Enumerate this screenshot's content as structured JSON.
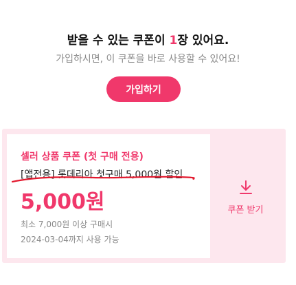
{
  "header": {
    "headline_prefix": "받을 수 있는 쿠폰이 ",
    "headline_count": "1",
    "headline_suffix": "장 있어요.",
    "subline": "가입하시면, 이 쿠폰을 바로 사용할 수 있어요!",
    "join_button": "가입하기"
  },
  "coupon": {
    "tag": "셀러 상품 쿠폰 (첫 구매 전용)",
    "name": "[앱전용] 롯데리아 첫구매 5,000원 할인",
    "amount": "5,000원",
    "condition": "최소 7,000원 이상 구매시",
    "expiry": "2024-03-04까지 사용 가능",
    "download_label": "쿠폰 받기",
    "download_icon": "download-arrow-icon"
  },
  "colors": {
    "accent": "#f0386b",
    "coupon_bg": "#fde7ee",
    "muted_text": "#8a8a8a",
    "strike_mark": "#e3182d"
  }
}
